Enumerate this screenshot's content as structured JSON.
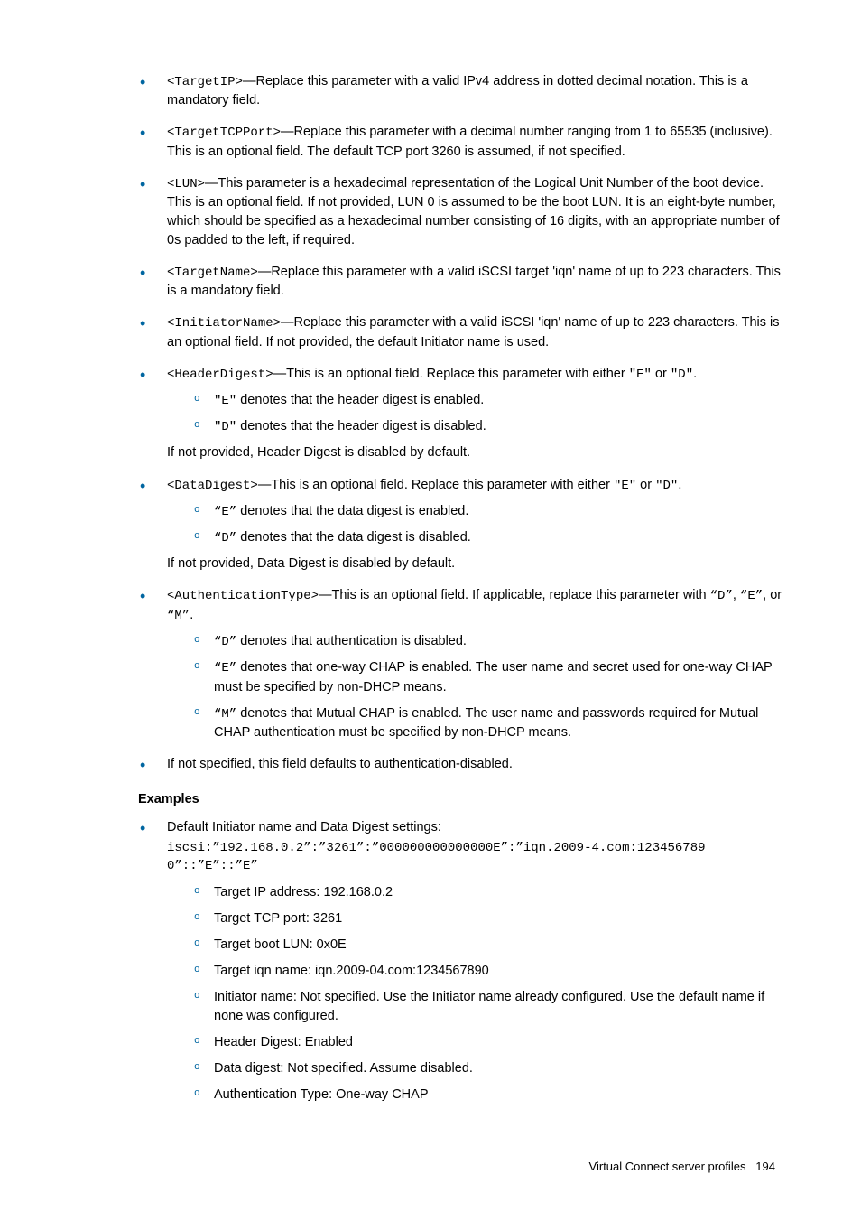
{
  "items": [
    {
      "prefix_code": "<TargetIP>",
      "text": "—Replace this parameter with a valid IPv4 address in dotted decimal notation. This is a mandatory field."
    },
    {
      "prefix_code": "<TargetTCPPort>",
      "text": "—Replace this parameter with a decimal number ranging from 1 to 65535 (inclusive). This is an optional field. The default TCP port 3260 is assumed, if not specified."
    },
    {
      "prefix_code": "<LUN>",
      "text": "—This parameter is a hexadecimal representation of the Logical Unit Number of the boot device. This is an optional field. If not provided, LUN 0 is assumed to be the boot LUN. It is an eight-byte number, which should be specified as a hexadecimal number consisting of 16 digits, with an appropriate number of 0s padded to the left, if required."
    },
    {
      "prefix_code": "<TargetName>",
      "text": "—Replace this parameter with a valid iSCSI target 'iqn' name of up to 223 characters. This is a mandatory field."
    },
    {
      "prefix_code": "<InitiatorName>",
      "text": "—Replace this parameter with a valid iSCSI 'iqn' name of up to 223 characters. This is an optional field. If not provided, the default Initiator name is used."
    }
  ],
  "headerDigest": {
    "prefix_code": "<HeaderDigest>",
    "text": "—This is an optional field. Replace this parameter with either ",
    "opt1": "\"E\"",
    "mid": " or ",
    "opt2": "\"D\"",
    "end": ".",
    "sub": [
      {
        "code": "\"E\"",
        "text": " denotes that the header digest is enabled."
      },
      {
        "code": "\"D\"",
        "text": " denotes that the header digest is disabled."
      }
    ],
    "after": "If not provided, Header Digest is disabled by default."
  },
  "dataDigest": {
    "prefix_code": "<DataDigest>",
    "text": "—This is an optional field. Replace this parameter with either ",
    "opt1": "\"E\"",
    "mid": " or ",
    "opt2": "\"D\"",
    "end": ".",
    "sub": [
      {
        "code": "“E”",
        "text": " denotes that the data digest is enabled."
      },
      {
        "code": "“D”",
        "text": " denotes that the data digest is disabled."
      }
    ],
    "after": "If not provided, Data Digest is disabled by default."
  },
  "authType": {
    "prefix_code": "<AuthenticationType>",
    "text": "—This is an optional field. If applicable, replace this parameter with ",
    "opt1": "“D”",
    "mid1": ", ",
    "opt2": "“E”",
    "mid2": ", or ",
    "opt3": "“M”",
    "end": ".",
    "sub": [
      {
        "code": "“D”",
        "text": " denotes that authentication is disabled."
      },
      {
        "code": "“E”",
        "text": " denotes that one-way CHAP is enabled. The user name and secret used for one-way CHAP must be specified by non-DHCP means."
      },
      {
        "code": "“M”",
        "text": " denotes that Mutual CHAP is enabled. The user name and passwords required for Mutual CHAP authentication must be specified by non-DHCP means."
      }
    ]
  },
  "authAfter": "If not specified, this field defaults to authentication-disabled.",
  "examplesHeading": "Examples",
  "example": {
    "intro": "Default Initiator name and Data Digest settings:",
    "code": "iscsi:”192.168.0.2”:”3261”:”000000000000000E”:”iqn.2009-4.com:1234567890”::”E”::”E”",
    "sub": [
      "Target IP address: 192.168.0.2",
      "Target TCP port: 3261",
      "Target boot LUN: 0x0E",
      "Target iqn name: iqn.2009-04.com:1234567890",
      "Initiator name: Not specified. Use the Initiator name already configured. Use the default name if none was configured.",
      "Header Digest: Enabled",
      "Data digest: Not specified. Assume disabled.",
      "Authentication Type: One-way CHAP"
    ]
  },
  "footer": {
    "section": "Virtual Connect server profiles",
    "page": "194"
  }
}
